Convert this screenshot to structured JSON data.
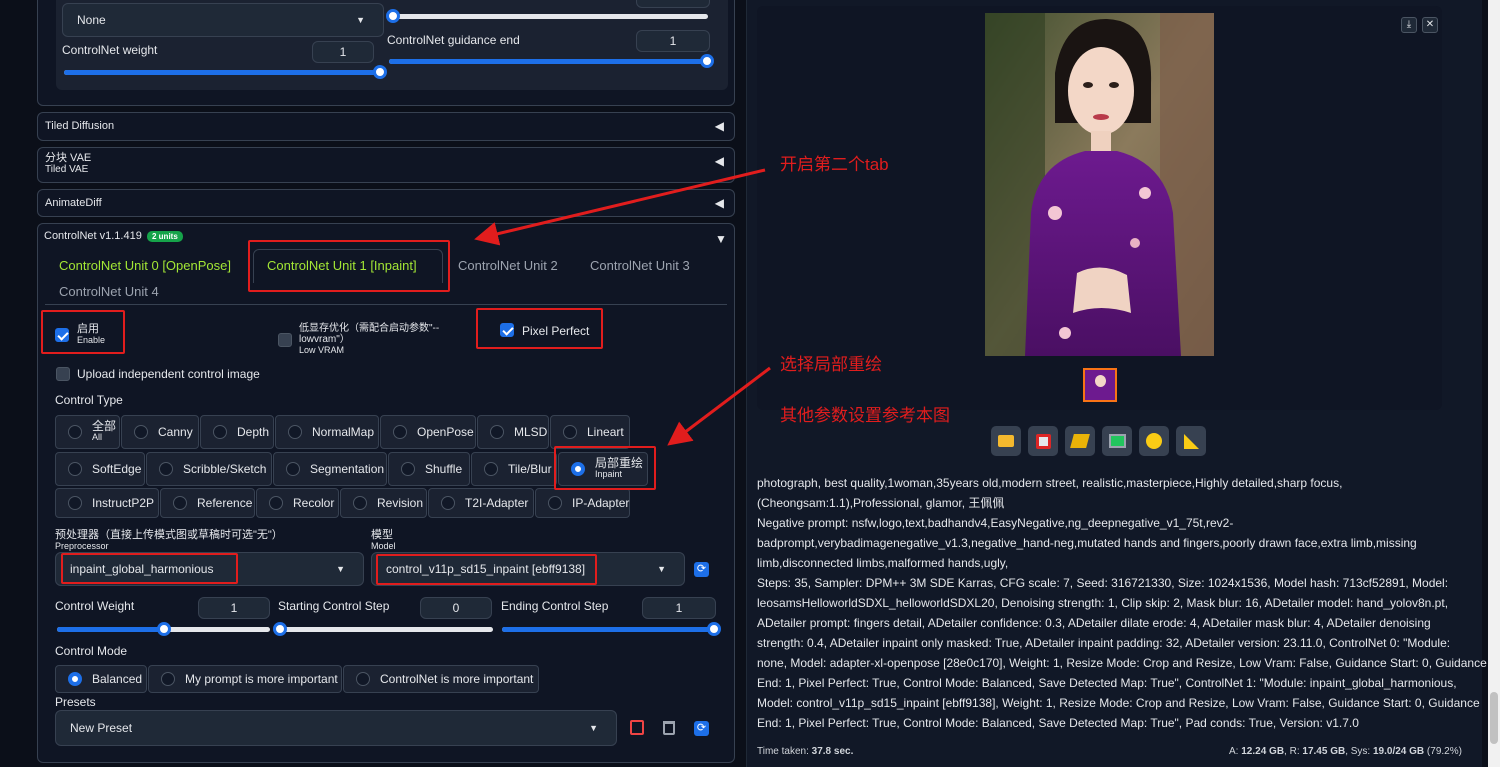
{
  "top_controls": {
    "preprocessor_value": "None",
    "weight_label": "ControlNet weight",
    "weight_value": "1",
    "guidance_end_label": "ControlNet guidance end",
    "guidance_end_value": "1",
    "weight_fraction": 1.0,
    "guidance_end_fraction": 1.0
  },
  "accordions": [
    {
      "title": "Tiled Diffusion"
    },
    {
      "title": "分块 VAE",
      "subtitle": "Tiled VAE"
    },
    {
      "title": "AnimateDiff"
    }
  ],
  "controlnet": {
    "title": "ControlNet v1.1.419",
    "badge": "2 units",
    "tabs": [
      "ControlNet Unit 0 [OpenPose]",
      "ControlNet Unit 1 [Inpaint]",
      "ControlNet Unit 2",
      "ControlNet Unit 3",
      "ControlNet Unit 4"
    ],
    "enable_cn": "启用",
    "enable_en": "Enable",
    "lowvram_cn": "低显存优化（需配合启动参数\"--lowvram\"）",
    "lowvram_en": "Low VRAM",
    "pixel_perfect": "Pixel Perfect",
    "upload_independent": "Upload independent control image",
    "control_type_label": "Control Type",
    "types_row1": [
      "Canny",
      "Depth",
      "NormalMap",
      "OpenPose",
      "MLSD",
      "Lineart"
    ],
    "all_cn": "全部",
    "all_en": "All",
    "types_row2": [
      "SoftEdge",
      "Scribble/Sketch",
      "Segmentation",
      "Shuffle",
      "Tile/Blur"
    ],
    "inpaint_cn": "局部重绘",
    "inpaint_en": "Inpaint",
    "types_row3": [
      "InstructP2P",
      "Reference",
      "Recolor",
      "Revision",
      "T2I-Adapter",
      "IP-Adapter"
    ],
    "preprocessor_label_cn": "预处理器（直接上传模式图或草稿时可选\"无\"）",
    "preprocessor_label_en": "Preprocessor",
    "preprocessor_value": "inpaint_global_harmonious",
    "model_label_cn": "模型",
    "model_label_en": "Model",
    "model_value": "control_v11p_sd15_inpaint [ebff9138]",
    "control_weight_label": "Control Weight",
    "control_weight_value": "1",
    "start_step_label": "Starting Control Step",
    "start_step_value": "0",
    "end_step_label": "Ending Control Step",
    "end_step_value": "1",
    "control_weight_fraction": 0.5,
    "start_step_fraction": 0.0,
    "end_step_fraction": 1.0,
    "control_mode_label": "Control Mode",
    "modes": [
      "Balanced",
      "My prompt is more important",
      "ControlNet is more important"
    ],
    "presets_label": "Presets",
    "preset_value": "New Preset"
  },
  "annotations": {
    "tab_note": "开启第二个tab",
    "inpaint_note": "选择局部重绘",
    "params_note": "其他参数设置参考本图"
  },
  "output": {
    "tool_icons": [
      "folder-icon",
      "save-icon",
      "zip-icon",
      "image-icon",
      "palette-icon",
      "ruler-icon"
    ],
    "info_lines": [
      "photograph, best quality,1woman,35years old,modern street, realistic,masterpiece,Highly detailed,sharp focus,",
      "(Cheongsam:1.1),Professional, glamor, 王佩佩",
      "Negative prompt: nsfw,logo,text,badhandv4,EasyNegative,ng_deepnegative_v1_75t,rev2-",
      "badprompt,verybadimagenegative_v1.3,negative_hand-neg,mutated hands and fingers,poorly drawn face,extra limb,missing",
      "limb,disconnected limbs,malformed hands,ugly,",
      "Steps: 35, Sampler: DPM++ 3M SDE Karras, CFG scale: 7, Seed: 316721330, Size: 1024x1536, Model hash: 713cf52891, Model:",
      "leosamsHelloworldSDXL_helloworldSDXL20, Denoising strength: 1, Clip skip: 2, Mask blur: 16, ADetailer model: hand_yolov8n.pt,",
      "ADetailer prompt: fingers detail, ADetailer confidence: 0.3, ADetailer dilate erode: 4, ADetailer mask blur: 4, ADetailer denoising",
      "strength: 0.4, ADetailer inpaint only masked: True, ADetailer inpaint padding: 32, ADetailer version: 23.11.0, ControlNet 0: \"Module:",
      "none, Model: adapter-xl-openpose [28e0c170], Weight: 1, Resize Mode: Crop and Resize, Low Vram: False, Guidance Start: 0, Guidance",
      "End: 1, Pixel Perfect: True, Control Mode: Balanced, Save Detected Map: True\", ControlNet 1: \"Module: inpaint_global_harmonious,",
      "Model: control_v11p_sd15_inpaint [ebff9138], Weight: 1, Resize Mode: Crop and Resize, Low Vram: False, Guidance Start: 0, Guidance",
      "End: 1, Pixel Perfect: True, Control Mode: Balanced, Save Detected Map: True\", Pad conds: True, Version: v1.7.0"
    ],
    "time_label": "Time taken: ",
    "time_value": "37.8 sec.",
    "mem_a_label": "A: ",
    "mem_a": "12.24 GB",
    "mem_r_label": ", R: ",
    "mem_r": "17.45 GB",
    "mem_sys_label": ", Sys: ",
    "mem_sys": "19.0/24 GB",
    "mem_pct": " (79.2%)"
  },
  "colors": {
    "accent": "#1d6fe8",
    "active_tab": "#a3e635",
    "annotation": "#e11d1d",
    "badge": "#16a34a"
  }
}
